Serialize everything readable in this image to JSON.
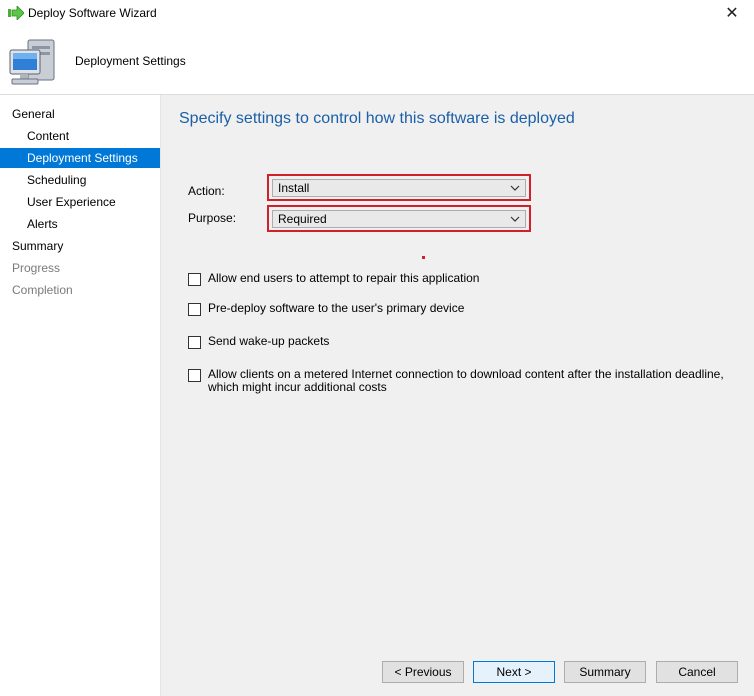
{
  "window": {
    "title": "Deploy Software Wizard",
    "close_glyph": "✕"
  },
  "header": {
    "title": "Deployment Settings"
  },
  "nav": {
    "items": [
      {
        "label": "General",
        "state": "normal"
      },
      {
        "label": "Content",
        "state": "normal"
      },
      {
        "label": "Deployment Settings",
        "state": "active"
      },
      {
        "label": "Scheduling",
        "state": "normal"
      },
      {
        "label": "User Experience",
        "state": "normal"
      },
      {
        "label": "Alerts",
        "state": "normal"
      },
      {
        "label": "Summary",
        "state": "normal"
      },
      {
        "label": "Progress",
        "state": "disabled"
      },
      {
        "label": "Completion",
        "state": "disabled"
      }
    ]
  },
  "main": {
    "heading": "Specify settings to control how this software is deployed",
    "action": {
      "label": "Action:",
      "value": "Install"
    },
    "purpose": {
      "label": "Purpose:",
      "value": "Required"
    },
    "options": [
      {
        "label": "Allow end users to attempt to repair this application",
        "checked": false
      },
      {
        "label": "Pre-deploy software to the user's primary device",
        "checked": false
      },
      {
        "label": "Send wake-up packets",
        "checked": false
      },
      {
        "label": "Allow clients on a metered Internet connection to download content after the installation deadline, which might incur additional costs",
        "checked": false
      }
    ]
  },
  "footer": {
    "previous": "< Previous",
    "next": "Next >",
    "summary": "Summary",
    "cancel": "Cancel"
  },
  "colors": {
    "accent": "#0078d7",
    "highlight_frame": "#d0202a",
    "heading": "#1a5fa8"
  },
  "icons": {
    "title": "green-arrow-icon",
    "header": "computer-icon",
    "dropdown": "chevron-down-icon"
  }
}
